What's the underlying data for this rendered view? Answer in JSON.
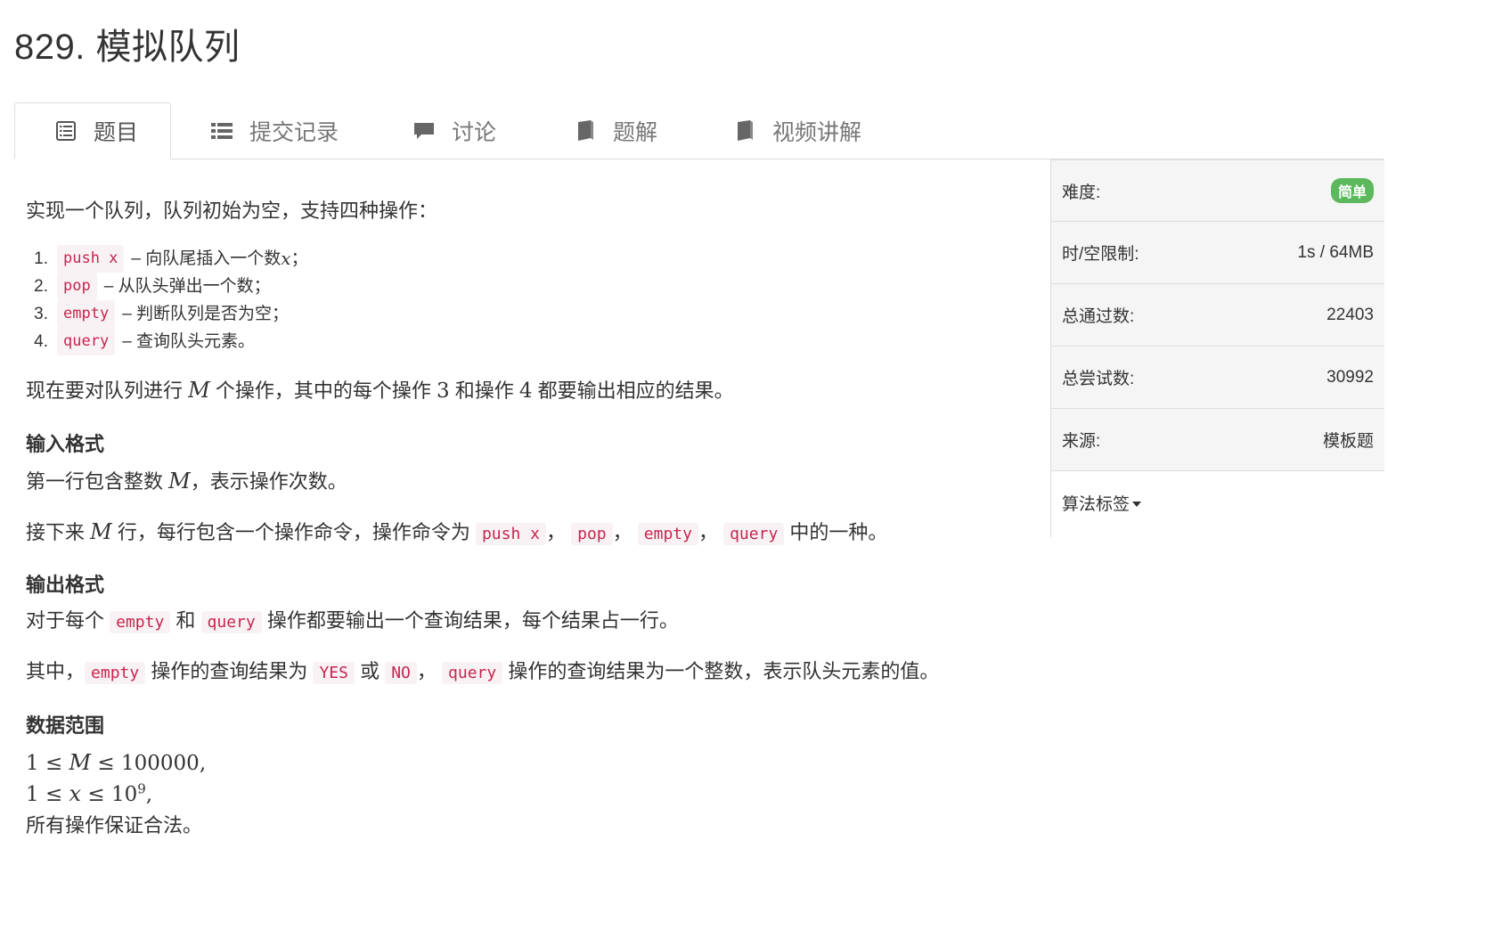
{
  "problem": {
    "title": "829. 模拟队列"
  },
  "tabs": [
    {
      "label": "题目",
      "icon": "list-alt-icon"
    },
    {
      "label": "提交记录",
      "icon": "th-list-icon"
    },
    {
      "label": "讨论",
      "icon": "comment-icon"
    },
    {
      "label": "题解",
      "icon": "book-icon"
    },
    {
      "label": "视频讲解",
      "icon": "book-icon"
    }
  ],
  "content": {
    "intro": "实现一个队列，队列初始为空，支持四种操作：",
    "ops": [
      {
        "num": "1.",
        "code": "push x",
        "text": "– 向队尾插入一个数 ",
        "var": "x",
        "end": "；"
      },
      {
        "num": "2.",
        "code": "pop",
        "text": "– 从队头弹出一个数；"
      },
      {
        "num": "3.",
        "code": "empty",
        "text": "– 判断队列是否为空；"
      },
      {
        "num": "4.",
        "code": "query",
        "text": "– 查询队头元素。"
      }
    ],
    "desc": {
      "p1": "现在要对队列进行 ",
      "m": "M",
      "p2": " 个操作，其中的每个操作 ",
      "n3": "3",
      "p3": " 和操作 ",
      "n4": "4",
      "p4": " 都要输出相应的结果。"
    },
    "input_heading": "输入格式",
    "input_line1": {
      "a": "第一行包含整数 ",
      "m": "M",
      "b": "，表示操作次数。"
    },
    "input_line2": {
      "a": "接下来 ",
      "m": "M",
      "b": " 行，每行包含一个操作命令，操作命令为 ",
      "c1": "push x",
      "sep1": "，",
      "c2": "pop",
      "sep2": "，",
      "c3": "empty",
      "sep3": "，",
      "c4": "query",
      "end": " 中的一种。"
    },
    "output_heading": "输出格式",
    "output_line1": {
      "a": "对于每个 ",
      "c1": "empty",
      "b": " 和 ",
      "c2": "query",
      "c": " 操作都要输出一个查询结果，每个结果占一行。"
    },
    "output_line2": {
      "a": "其中，",
      "c1": "empty",
      "b": " 操作的查询结果为 ",
      "c2": "YES",
      "c": " 或 ",
      "c3": "NO",
      "d": "，",
      "c4": "query",
      "e": " 操作的查询结果为一个整数，表示队头元素的值。"
    },
    "range_heading": "数据范围",
    "range1": {
      "a": "1 ≤ ",
      "v": "M",
      "b": " ≤ 100000",
      "end": ","
    },
    "range2": {
      "a": "1 ≤ ",
      "v": "x",
      "b": " ≤ 10",
      "sup": "9",
      "end": ","
    },
    "range3": "所有操作保证合法。"
  },
  "sidebar": {
    "rows": [
      {
        "label": "难度:",
        "value": "简单"
      },
      {
        "label": "时/空限制:",
        "value": "1s / 64MB"
      },
      {
        "label": "总通过数:",
        "value": "22403"
      },
      {
        "label": "总尝试数:",
        "value": "30992"
      },
      {
        "label": "来源:",
        "value": "模板题"
      }
    ],
    "tags_label": "算法标签"
  },
  "colors": {
    "accent_green": "#5cb85c",
    "code_red": "#c7254e",
    "code_bg": "#f9f2f4"
  }
}
